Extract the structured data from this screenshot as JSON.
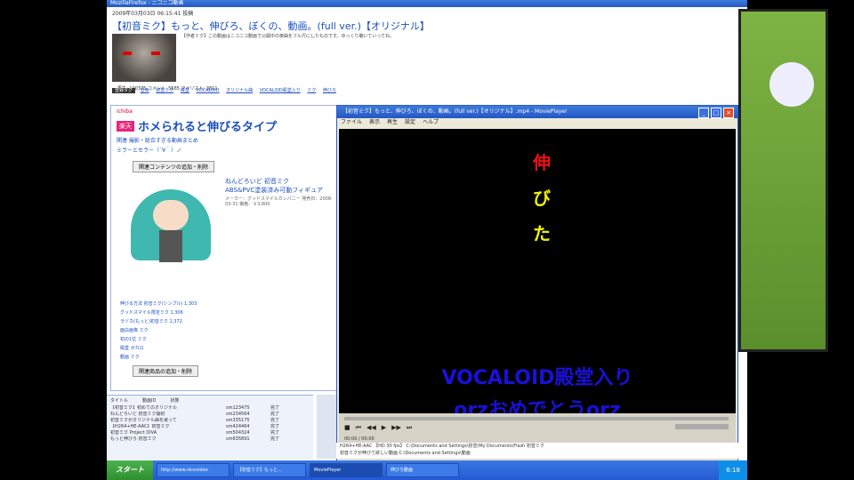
{
  "browser": {
    "window_title": "MozillaFirefox - ニコニコ動画",
    "video_date": "2009年03月03日 06:15:41 投稿",
    "video_title": "【初音ミク】もっと、伸びろ、ぼくの、動画。(full ver.)【オリジナル】",
    "description": "【作者ミク】この動画はニコニコ動画で公開中の楽曲をフル尺にしたものです。ゆっくり聴いていってね。",
    "stats": "再生: 100375 コメント: 5585 マイリスト: 3811",
    "tag_lock": "登録タグ",
    "tags": [
      "音楽",
      "初音ミク",
      "殿堂",
      "VOCALOID",
      "オリジナル曲",
      "VOCALOID殿堂入り",
      "ミク",
      "伸びろ"
    ]
  },
  "ad": {
    "shop_logo": "ichiba",
    "badge": "楽天",
    "title": "ホメられると伸びるタイプ",
    "sub1": "関連 撮影・総合すぎる動画まとめ",
    "sub2": "ミラーとセラー（´∀｀）ノ",
    "button": "関連コンテンツの追加・削除",
    "product_title": "ねんどろいど 初音ミク",
    "product_sub": "ABS&PVC塗装済み可動フィギュア",
    "product_details": "メーカー：グッドスマイルカンパニー 発売日：2008-03-31 価格：￥3,800",
    "links": [
      "伸びる方法 初音ミク(シンプル) 1,303",
      "グッドスマイル限定ミク 1,306",
      "ラゾカ(もっと)初音ミク 1,372",
      "面白画像 ミク",
      "初の1位 ミク",
      "殿堂 ボカロ",
      "動画 ミク"
    ],
    "button2": "関連商品の追加・削除"
  },
  "list": {
    "headers": [
      "タイトル",
      "動画ID",
      "状態"
    ],
    "rows": [
      [
        "【初音ミク】初めてのオリジナル",
        "sm123475",
        "完了"
      ],
      [
        "ねんどろいど 初音ミク開封",
        "sm234564",
        "完了"
      ],
      [
        "初音ミクがオリジナル曲を歌って",
        "sm335175",
        "完了"
      ],
      [
        "【H264+HE-AAC】初音ミク",
        "sm424464",
        "完了"
      ],
      [
        "初音ミク Project DIVA",
        "sm504324",
        "完了"
      ],
      [
        "もっと伸びろ 初音ミク",
        "sm635891",
        "完了"
      ]
    ]
  },
  "player": {
    "title": "【初音ミク】もっと、伸びろ、ぼくの、動画。(full ver.)【オリジナル】.mp4 - MoviePlayer",
    "menu": [
      "ファイル",
      "表示",
      "再生",
      "設定",
      "ヘルプ"
    ],
    "video_chars": [
      "伸",
      "び",
      "た"
    ],
    "video_char_colors": [
      "#ee1111",
      "#f2f206",
      "#f2f206"
    ],
    "overlay_line1": "VOCALOID殿堂入り",
    "overlay_line2": "orzおめでとうorz",
    "time": "00:00 / 00:00",
    "info1": "H264+HE-AAC 【HD 30 fps】 C:\\Documents and Settings\\初音\\My Documents\\Flash 初音ミク",
    "info2": "初音ミクが伸びて欲しい動画 C:\\Documents and Settings\\動画"
  },
  "taskbar": {
    "start": "スタート",
    "buttons": [
      "http://www.nicovideo",
      "【初音ミク】もっと...",
      "MoviePlayer",
      "伸びろ動画"
    ],
    "time": "6:18"
  }
}
